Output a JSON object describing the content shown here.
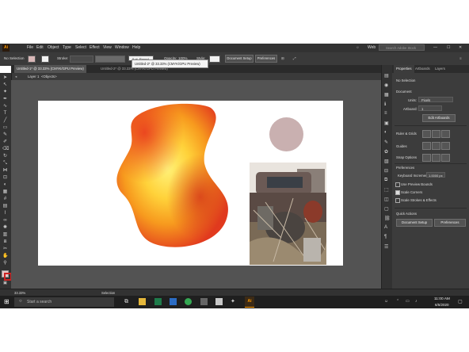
{
  "menubar": {
    "logo": "Ai",
    "items": [
      "File",
      "Edit",
      "Object",
      "Type",
      "Select",
      "Effect",
      "View",
      "Window",
      "Help"
    ],
    "workspace": "Web",
    "search_placeholder": "Search Adobe Stock"
  },
  "control": {
    "selection_label": "No Selection",
    "stroke_label": "Stroke:",
    "brush_label": "5 pt. Round",
    "opacity_label": "Opacity:",
    "opacity_value": "100%",
    "style_label": "Style:",
    "document_setup": "Document Setup",
    "preferences": "Preferences"
  },
  "tabs": [
    {
      "label": "Untitled-1* @ 33.33% (CMYK/GPU Preview)",
      "active": true
    },
    {
      "label": "Untitled-2* @ 33.33% (CMYK/GPU Preview)",
      "active": false
    }
  ],
  "tooltip": "Untitled-2* @ 33.33% (CMYK/GPU Preview)",
  "breadcrumb": {
    "layer": "Layer 1",
    "objects": "<Objects>"
  },
  "panel": {
    "tabs": [
      "Properties",
      "Artboards",
      "Layers"
    ],
    "no_selection": "No Selection",
    "document_heading": "Document",
    "units_label": "Units:",
    "units_value": "Pixels",
    "artboard_label": "Artboard:",
    "artboard_value": "1",
    "edit_artboards": "Edit Artboards",
    "ruler_grids": "Ruler & Grids",
    "guides": "Guides",
    "snap_options": "Snap Options",
    "preferences_heading": "Preferences",
    "keyboard_increment_label": "Keyboard Increment:",
    "keyboard_increment_value": "1.0000 px",
    "use_preview_bounds": "Use Preview Bounds",
    "scale_corners": "Scale Corners",
    "scale_strokes": "Scale Strokes & Effects",
    "quick_actions": "Quick Actions",
    "qa_document_setup": "Document Setup",
    "qa_preferences": "Preferences"
  },
  "status": {
    "zoom": "33.33%",
    "tool": "Selection"
  },
  "taskbar": {
    "search_placeholder": "Start a search",
    "time": "11:00 AM",
    "date": "6/5/2020"
  },
  "colors": {
    "accent": "#ff9a00",
    "circle": "#c9b0b0"
  }
}
